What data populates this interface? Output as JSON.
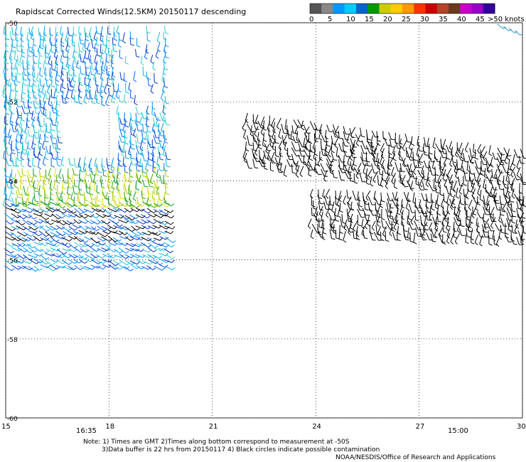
{
  "title": "Rapidscat Corrected Winds(12.5KM) 20150117 descending",
  "legend": {
    "labels": [
      "0",
      "5",
      "10",
      "15",
      "20",
      "25",
      "30",
      "35",
      "40",
      "45",
      ">50 knots"
    ],
    "colors": [
      "#555555",
      "#888888",
      "#0099ff",
      "#00ccff",
      "#0066cc",
      "#009900",
      "#cccc00",
      "#ffcc00",
      "#ff9900",
      "#ff3300",
      "#cc0000",
      "#b3442a",
      "#6b3a1e",
      "#cc00cc",
      "#9900cc",
      "#330099"
    ]
  },
  "lat_labels": [
    "-50",
    "-52",
    "-54",
    "-56",
    "-58",
    "-60"
  ],
  "lon_labels": [
    "15",
    "18",
    "21",
    "24",
    "27",
    "30"
  ],
  "time_labels": [
    "16:35",
    "15:00"
  ],
  "time_color": "#660099",
  "notes": {
    "line1": "Note: 1) Times are GMT 2)Times along bottom correspond to measurement at -50S",
    "line2": "3)Data buffer is 22 hrs from 20150117 4) Black circles indicate possible contamination",
    "line3": "NOAA/NESDIS/Office of Research and Applications"
  },
  "chart_data": {
    "type": "scatter",
    "xlim": [
      15,
      30
    ],
    "ylim": [
      -60,
      -50
    ],
    "xlabel": "",
    "ylabel": "",
    "swaths": [
      {
        "lon": [
          15.0,
          19.8
        ],
        "lat": [
          -57.0,
          -50.0
        ]
      },
      {
        "lon": [
          22.1,
          30.0
        ],
        "lat": [
          -56.0,
          -52.3
        ]
      },
      {
        "lon": [
          29.2,
          30.0
        ],
        "lat": [
          -50.4,
          -50.0
        ]
      }
    ],
    "grid": true
  }
}
